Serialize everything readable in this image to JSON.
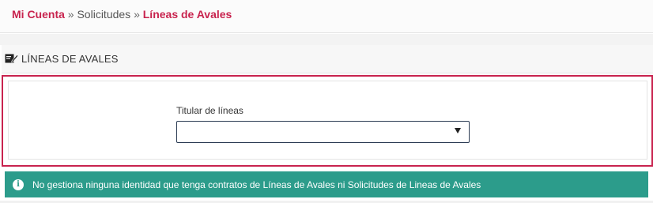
{
  "breadcrumb": {
    "home": "Mi Cuenta",
    "sep1": "»",
    "middle": "Solicitudes",
    "sep2": "»",
    "current": "Líneas de Avales"
  },
  "section": {
    "title": "LÍNEAS DE AVALES",
    "icon": "edit-document-icon"
  },
  "form": {
    "field_label": "Titular de líneas",
    "select_value": ""
  },
  "alert": {
    "icon": "info-circle-icon",
    "message": "No gestiona ninguna identidad que tenga contratos de Líneas de Avales ni Solicitudes de Lineas de Avales",
    "color": "#2c9c8b"
  },
  "colors": {
    "accent": "#c8234e"
  }
}
